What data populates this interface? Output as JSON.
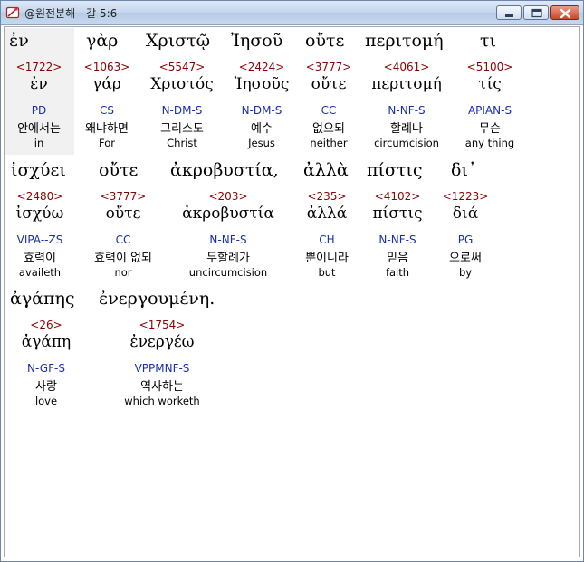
{
  "window": {
    "title": "@원전분해 - 갈 5:6",
    "buttons": {
      "minimize": "minimize",
      "maximize": "maximize",
      "close": "close"
    }
  },
  "colors": {
    "strong": "#8b0000",
    "morph": "#1a2fb0",
    "text": "#000000",
    "selected_bg": "#f1f1f1"
  },
  "rows": [
    {
      "words": [
        {
          "greek": "ἐν",
          "strong": "<1722>",
          "lemma": "ἐν",
          "morph": "PD",
          "korean": "안에서는",
          "english": "in"
        },
        {
          "greek": "γὰρ",
          "strong": "<1063>",
          "lemma": "γάρ",
          "morph": "CS",
          "korean": "왜냐하면",
          "english": "For"
        },
        {
          "greek": "Χριστῷ",
          "strong": "<5547>",
          "lemma": "Χριστός",
          "morph": "N-DM-S",
          "korean": "그리스도",
          "english": "Christ"
        },
        {
          "greek": "Ἰησοῦ",
          "strong": "<2424>",
          "lemma": "Ἰησοῦς",
          "morph": "N-DM-S",
          "korean": "예수",
          "english": "Jesus"
        },
        {
          "greek": "οὔτε",
          "strong": "<3777>",
          "lemma": "οὔτε",
          "morph": "CC",
          "korean": "없으되",
          "english": "neither"
        },
        {
          "greek": "περιτομή",
          "strong": "<4061>",
          "lemma": "περιτομή",
          "morph": "N-NF-S",
          "korean": "할례나",
          "english": "circumcision"
        },
        {
          "greek": "τι",
          "strong": "<5100>",
          "lemma": "τίς",
          "morph": "APIAN-S",
          "korean": "무슨",
          "english": "any thing"
        }
      ]
    },
    {
      "words": [
        {
          "greek": "ἰσχύει",
          "strong": "<2480>",
          "lemma": "ἰσχύω",
          "morph": "VIPA--ZS",
          "korean": "효력이",
          "english": "availeth"
        },
        {
          "greek": "οὔτε",
          "strong": "<3777>",
          "lemma": "οὔτε",
          "morph": "CC",
          "korean": "효력이 없되",
          "english": "nor"
        },
        {
          "greek": "ἀκροβυστία,",
          "strong": "<203>",
          "lemma": "ἀκροβυστία",
          "morph": "N-NF-S",
          "korean": "무할례가",
          "english": "uncircumcision"
        },
        {
          "greek": "ἀλλὰ",
          "strong": "<235>",
          "lemma": "ἀλλά",
          "morph": "CH",
          "korean": "뿐이니라",
          "english": "but"
        },
        {
          "greek": "πίστις",
          "strong": "<4102>",
          "lemma": "πίστις",
          "morph": "N-NF-S",
          "korean": "믿음",
          "english": "faith"
        },
        {
          "greek": "δι᾽",
          "strong": "<1223>",
          "lemma": "διά",
          "morph": "PG",
          "korean": "으로써",
          "english": "by"
        }
      ]
    },
    {
      "words": [
        {
          "greek": "ἀγάπης",
          "strong": "<26>",
          "lemma": "ἀγάπη",
          "morph": "N-GF-S",
          "korean": "사랑",
          "english": "love"
        },
        {
          "greek": "ἐνεργουμένη.",
          "strong": "<1754>",
          "lemma": "ἐνεργέω",
          "morph": "VPPMNF-S",
          "korean": "역사하는",
          "english": "which worketh"
        }
      ]
    }
  ]
}
